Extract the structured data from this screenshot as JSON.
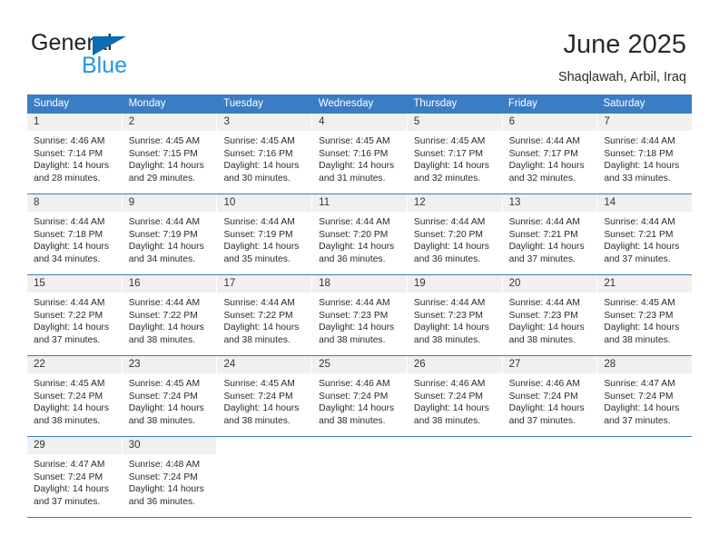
{
  "brand": {
    "name_part1": "General",
    "name_part2": "Blue",
    "triangle_color": "#0b6cb2",
    "blue_color": "#2196e8"
  },
  "header": {
    "title": "June 2025",
    "subtitle": "Shaqlawah, Arbil, Iraq"
  },
  "colors": {
    "header_blue": "#3b7dc4",
    "daynum_band": "#f0f0f0",
    "text": "#2b2b2b"
  },
  "calendar": {
    "weekdays": [
      "Sunday",
      "Monday",
      "Tuesday",
      "Wednesday",
      "Thursday",
      "Friday",
      "Saturday"
    ],
    "weeks": [
      [
        {
          "day": "1",
          "sunrise": "Sunrise: 4:46 AM",
          "sunset": "Sunset: 7:14 PM",
          "daylight": "Daylight: 14 hours and 28 minutes."
        },
        {
          "day": "2",
          "sunrise": "Sunrise: 4:45 AM",
          "sunset": "Sunset: 7:15 PM",
          "daylight": "Daylight: 14 hours and 29 minutes."
        },
        {
          "day": "3",
          "sunrise": "Sunrise: 4:45 AM",
          "sunset": "Sunset: 7:16 PM",
          "daylight": "Daylight: 14 hours and 30 minutes."
        },
        {
          "day": "4",
          "sunrise": "Sunrise: 4:45 AM",
          "sunset": "Sunset: 7:16 PM",
          "daylight": "Daylight: 14 hours and 31 minutes."
        },
        {
          "day": "5",
          "sunrise": "Sunrise: 4:45 AM",
          "sunset": "Sunset: 7:17 PM",
          "daylight": "Daylight: 14 hours and 32 minutes."
        },
        {
          "day": "6",
          "sunrise": "Sunrise: 4:44 AM",
          "sunset": "Sunset: 7:17 PM",
          "daylight": "Daylight: 14 hours and 32 minutes."
        },
        {
          "day": "7",
          "sunrise": "Sunrise: 4:44 AM",
          "sunset": "Sunset: 7:18 PM",
          "daylight": "Daylight: 14 hours and 33 minutes."
        }
      ],
      [
        {
          "day": "8",
          "sunrise": "Sunrise: 4:44 AM",
          "sunset": "Sunset: 7:18 PM",
          "daylight": "Daylight: 14 hours and 34 minutes."
        },
        {
          "day": "9",
          "sunrise": "Sunrise: 4:44 AM",
          "sunset": "Sunset: 7:19 PM",
          "daylight": "Daylight: 14 hours and 34 minutes."
        },
        {
          "day": "10",
          "sunrise": "Sunrise: 4:44 AM",
          "sunset": "Sunset: 7:19 PM",
          "daylight": "Daylight: 14 hours and 35 minutes."
        },
        {
          "day": "11",
          "sunrise": "Sunrise: 4:44 AM",
          "sunset": "Sunset: 7:20 PM",
          "daylight": "Daylight: 14 hours and 36 minutes."
        },
        {
          "day": "12",
          "sunrise": "Sunrise: 4:44 AM",
          "sunset": "Sunset: 7:20 PM",
          "daylight": "Daylight: 14 hours and 36 minutes."
        },
        {
          "day": "13",
          "sunrise": "Sunrise: 4:44 AM",
          "sunset": "Sunset: 7:21 PM",
          "daylight": "Daylight: 14 hours and 37 minutes."
        },
        {
          "day": "14",
          "sunrise": "Sunrise: 4:44 AM",
          "sunset": "Sunset: 7:21 PM",
          "daylight": "Daylight: 14 hours and 37 minutes."
        }
      ],
      [
        {
          "day": "15",
          "sunrise": "Sunrise: 4:44 AM",
          "sunset": "Sunset: 7:22 PM",
          "daylight": "Daylight: 14 hours and 37 minutes."
        },
        {
          "day": "16",
          "sunrise": "Sunrise: 4:44 AM",
          "sunset": "Sunset: 7:22 PM",
          "daylight": "Daylight: 14 hours and 38 minutes."
        },
        {
          "day": "17",
          "sunrise": "Sunrise: 4:44 AM",
          "sunset": "Sunset: 7:22 PM",
          "daylight": "Daylight: 14 hours and 38 minutes."
        },
        {
          "day": "18",
          "sunrise": "Sunrise: 4:44 AM",
          "sunset": "Sunset: 7:23 PM",
          "daylight": "Daylight: 14 hours and 38 minutes."
        },
        {
          "day": "19",
          "sunrise": "Sunrise: 4:44 AM",
          "sunset": "Sunset: 7:23 PM",
          "daylight": "Daylight: 14 hours and 38 minutes."
        },
        {
          "day": "20",
          "sunrise": "Sunrise: 4:44 AM",
          "sunset": "Sunset: 7:23 PM",
          "daylight": "Daylight: 14 hours and 38 minutes."
        },
        {
          "day": "21",
          "sunrise": "Sunrise: 4:45 AM",
          "sunset": "Sunset: 7:23 PM",
          "daylight": "Daylight: 14 hours and 38 minutes."
        }
      ],
      [
        {
          "day": "22",
          "sunrise": "Sunrise: 4:45 AM",
          "sunset": "Sunset: 7:24 PM",
          "daylight": "Daylight: 14 hours and 38 minutes."
        },
        {
          "day": "23",
          "sunrise": "Sunrise: 4:45 AM",
          "sunset": "Sunset: 7:24 PM",
          "daylight": "Daylight: 14 hours and 38 minutes."
        },
        {
          "day": "24",
          "sunrise": "Sunrise: 4:45 AM",
          "sunset": "Sunset: 7:24 PM",
          "daylight": "Daylight: 14 hours and 38 minutes."
        },
        {
          "day": "25",
          "sunrise": "Sunrise: 4:46 AM",
          "sunset": "Sunset: 7:24 PM",
          "daylight": "Daylight: 14 hours and 38 minutes."
        },
        {
          "day": "26",
          "sunrise": "Sunrise: 4:46 AM",
          "sunset": "Sunset: 7:24 PM",
          "daylight": "Daylight: 14 hours and 38 minutes."
        },
        {
          "day": "27",
          "sunrise": "Sunrise: 4:46 AM",
          "sunset": "Sunset: 7:24 PM",
          "daylight": "Daylight: 14 hours and 37 minutes."
        },
        {
          "day": "28",
          "sunrise": "Sunrise: 4:47 AM",
          "sunset": "Sunset: 7:24 PM",
          "daylight": "Daylight: 14 hours and 37 minutes."
        }
      ],
      [
        {
          "day": "29",
          "sunrise": "Sunrise: 4:47 AM",
          "sunset": "Sunset: 7:24 PM",
          "daylight": "Daylight: 14 hours and 37 minutes."
        },
        {
          "day": "30",
          "sunrise": "Sunrise: 4:48 AM",
          "sunset": "Sunset: 7:24 PM",
          "daylight": "Daylight: 14 hours and 36 minutes."
        },
        {
          "day": "",
          "sunrise": "",
          "sunset": "",
          "daylight": ""
        },
        {
          "day": "",
          "sunrise": "",
          "sunset": "",
          "daylight": ""
        },
        {
          "day": "",
          "sunrise": "",
          "sunset": "",
          "daylight": ""
        },
        {
          "day": "",
          "sunrise": "",
          "sunset": "",
          "daylight": ""
        },
        {
          "day": "",
          "sunrise": "",
          "sunset": "",
          "daylight": ""
        }
      ]
    ]
  }
}
